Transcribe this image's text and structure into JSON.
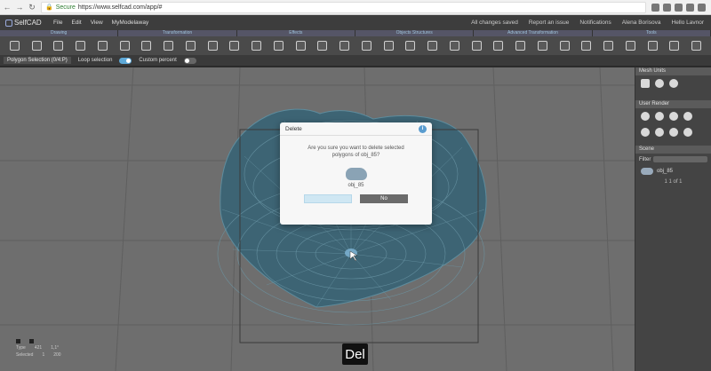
{
  "browser": {
    "back_glyph": "←",
    "forward_glyph": "→",
    "reload_glyph": "↻",
    "lock_glyph": "🔒",
    "secure_label": "Secure",
    "url": "https://www.selfcad.com/app/#"
  },
  "app": {
    "logo": "SelfCAD",
    "menu": [
      "File",
      "Edit",
      "View",
      "MyModelaway"
    ],
    "header_right": [
      "All changes saved",
      "Report an issue",
      "Notifications",
      "Alena Borisova",
      "Hello Lavnor"
    ]
  },
  "toolbar": {
    "groups": [
      "Drawing",
      "Transformation",
      "Effects",
      "Objects Structures",
      "Advanced Transformation",
      "Tools"
    ],
    "icons": [
      "draw-icon",
      "shape-icon",
      "select-icon",
      "cube-icon",
      "cylinder-icon",
      "sphere-icon",
      "cone-icon",
      "torus-icon",
      "move-icon",
      "rotate-icon",
      "scale-icon",
      "mirror-icon",
      "align-icon",
      "extrude-icon",
      "bevel-icon",
      "subdivide-icon",
      "union-icon",
      "subtract-icon",
      "intersect-icon",
      "stitch-icon",
      "split-icon",
      "sculpt-icon",
      "deform-icon",
      "twist-icon",
      "bend-icon",
      "taper-icon",
      "slice-icon",
      "measure-icon",
      "repair-icon",
      "export-icon",
      "print-icon",
      "render-icon"
    ]
  },
  "subbar": {
    "mode": "Polygon Selection (0/4:P)",
    "loop_selection": "Loop selection",
    "custom_percent": "Custom percent"
  },
  "right_panel": {
    "section1": "Mesh Units",
    "section2": "User Render",
    "section3": "Scene",
    "object_name": "obj_85",
    "pager": "1 1 of 1",
    "filter_label": "Filter"
  },
  "dialog": {
    "title": "Delete",
    "message": "Are you sure you want to delete selected polygons of obj_85?",
    "object": "obj_85",
    "yes_label": "",
    "no_label": "No"
  },
  "stats": {
    "labels": [
      "Type",
      "Selected"
    ],
    "col1": [
      "421",
      "1"
    ],
    "col2": [
      "1,1°",
      "200"
    ]
  },
  "overlay": {
    "hint": "",
    "key": "Del"
  }
}
